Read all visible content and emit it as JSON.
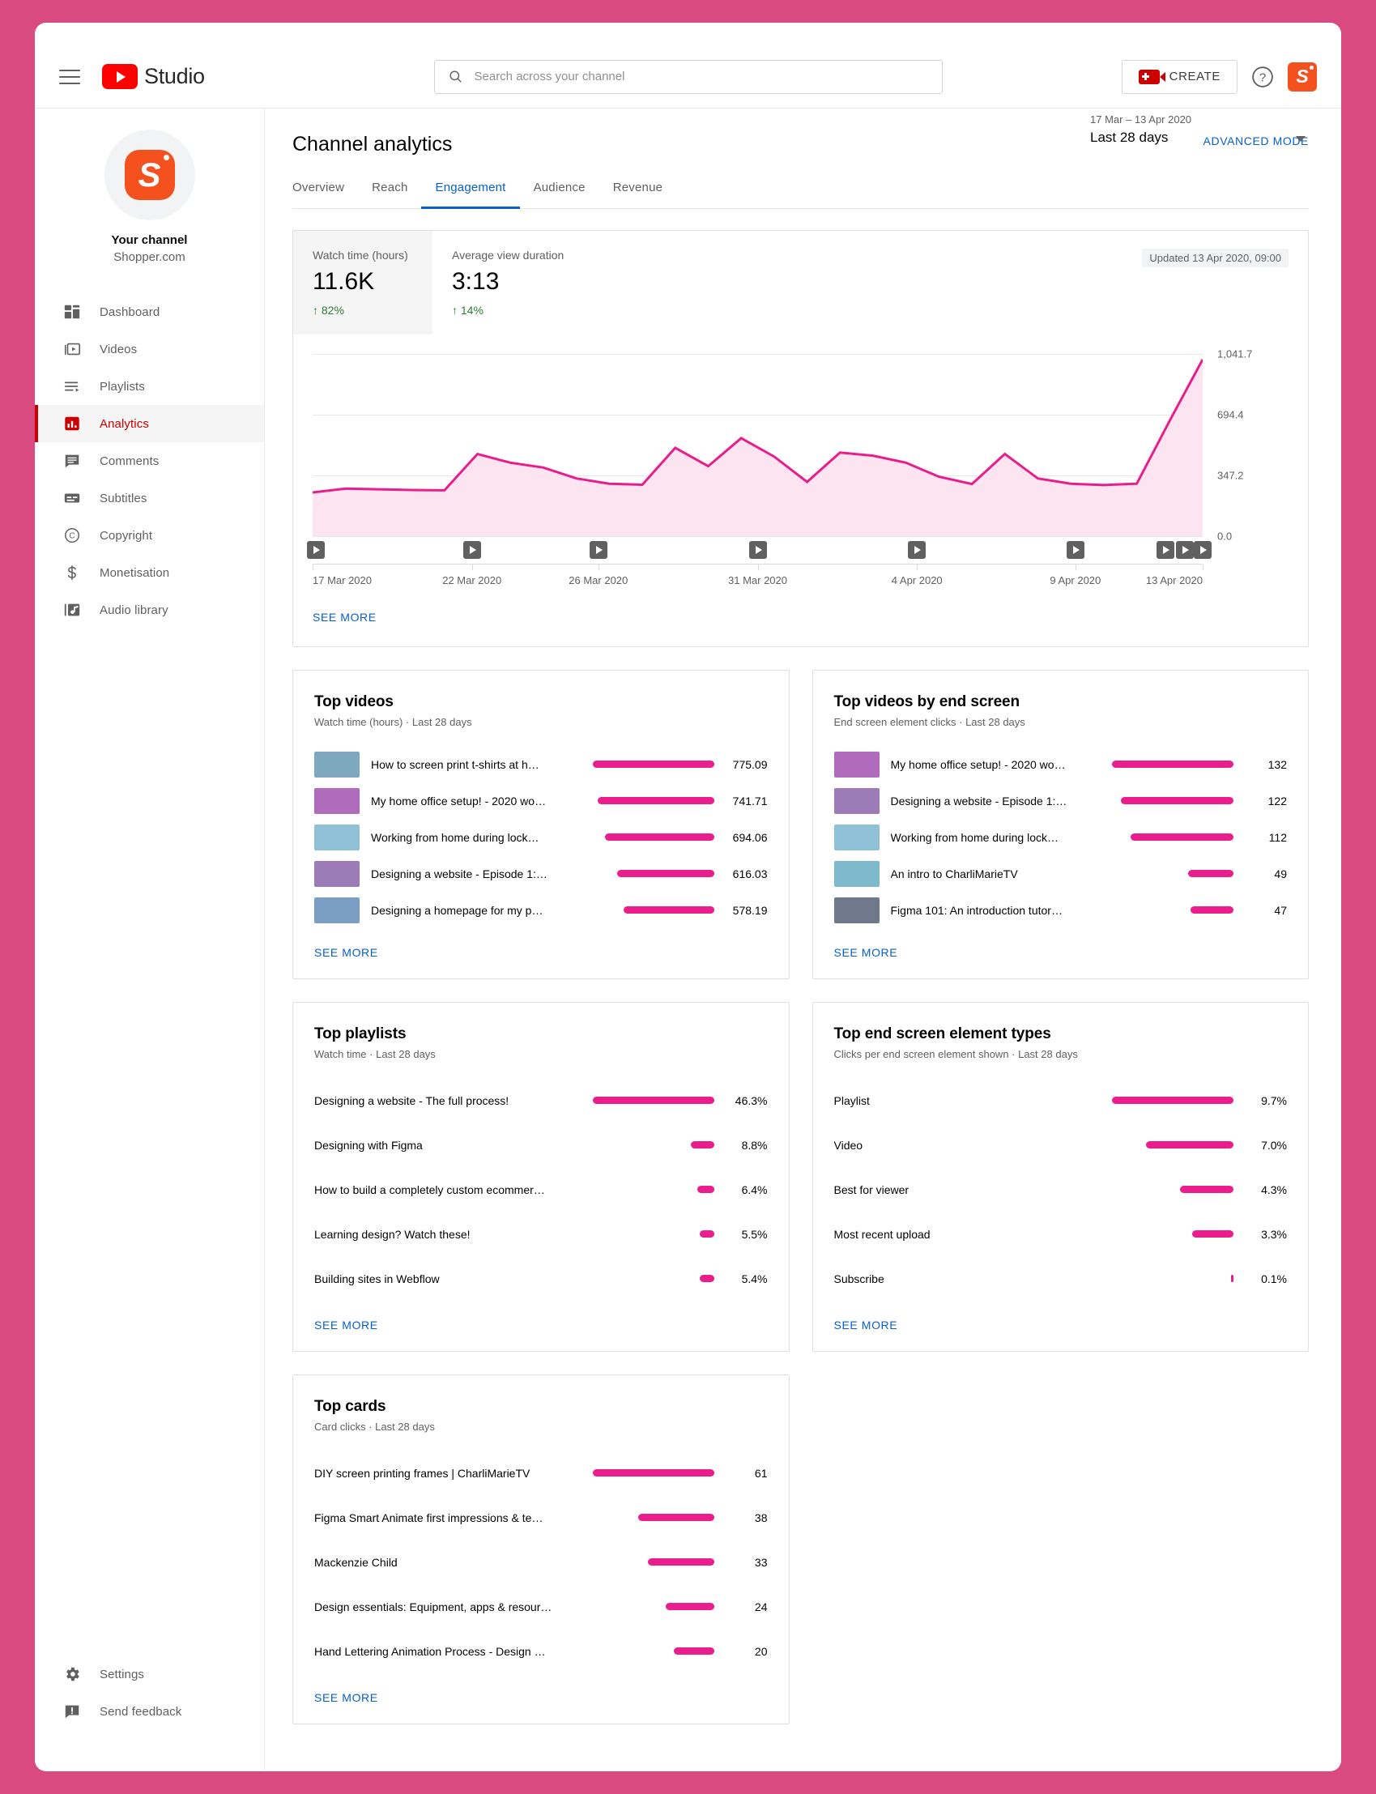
{
  "topbar": {
    "brand": "Studio",
    "search_placeholder": "Search across your channel",
    "search_value": "",
    "create_label": "CREATE",
    "avatar_letter": "S"
  },
  "sidebar": {
    "channel_label": "Your channel",
    "channel_name": "Shopper.com",
    "avatar_letter": "S",
    "items": [
      {
        "label": "Dashboard",
        "icon": "dashboard-icon",
        "active": false
      },
      {
        "label": "Videos",
        "icon": "videos-icon",
        "active": false
      },
      {
        "label": "Playlists",
        "icon": "playlists-icon",
        "active": false
      },
      {
        "label": "Analytics",
        "icon": "analytics-icon",
        "active": true
      },
      {
        "label": "Comments",
        "icon": "comments-icon",
        "active": false
      },
      {
        "label": "Subtitles",
        "icon": "subtitles-icon",
        "active": false
      },
      {
        "label": "Copyright",
        "icon": "copyright-icon",
        "active": false
      },
      {
        "label": "Monetisation",
        "icon": "dollar-icon",
        "active": false
      },
      {
        "label": "Audio library",
        "icon": "audio-library-icon",
        "active": false
      }
    ],
    "bottom_items": [
      {
        "label": "Settings",
        "icon": "gear-icon"
      },
      {
        "label": "Send feedback",
        "icon": "feedback-icon"
      }
    ]
  },
  "page": {
    "title": "Channel analytics",
    "advanced_mode": "ADVANCED MODE",
    "tabs": [
      {
        "label": "Overview",
        "active": false
      },
      {
        "label": "Reach",
        "active": false
      },
      {
        "label": "Engagement",
        "active": true
      },
      {
        "label": "Audience",
        "active": false
      },
      {
        "label": "Revenue",
        "active": false
      }
    ],
    "date_range": "17 Mar – 13 Apr 2020",
    "date_preset": "Last 28 days"
  },
  "overview_card": {
    "updated": "Updated 13 Apr 2020, 09:00",
    "see_more": "SEE MORE",
    "metrics": [
      {
        "label": "Watch time (hours)",
        "value": "11.6K",
        "delta": "82%",
        "arrow": "↑",
        "selected": true
      },
      {
        "label": "Average view duration",
        "value": "3:13",
        "delta": "14%",
        "arrow": "↑",
        "selected": false
      }
    ]
  },
  "chart_data": {
    "type": "area",
    "title": "Watch time (hours)",
    "xlabel": "",
    "ylabel": "Watch time (hours)",
    "ylim": [
      0.0,
      1041.7
    ],
    "ytick_labels": [
      "1,041.7",
      "694.4",
      "347.2",
      "0.0"
    ],
    "ytick_values": [
      1041.7,
      694.4,
      347.2,
      0.0
    ],
    "grid": true,
    "legend": "none",
    "line_color": "#e91e8c",
    "fill_color": "#fce4f0",
    "xtick_labels": [
      "17 Mar 2020",
      "22 Mar 2020",
      "26 Mar 2020",
      "31 Mar 2020",
      "4 Apr 2020",
      "9 Apr 2020",
      "13 Apr 2020"
    ],
    "xtick_positions": [
      0,
      17.9,
      32.1,
      50.0,
      67.9,
      85.7,
      100
    ],
    "x": [
      0,
      1,
      2,
      3,
      4,
      5,
      6,
      7,
      8,
      9,
      10,
      11,
      12,
      13,
      14,
      15,
      16,
      17,
      18,
      19,
      20,
      21,
      22,
      23,
      24,
      25,
      26,
      27
    ],
    "values": [
      250,
      272,
      268,
      264,
      262,
      470,
      420,
      392,
      330,
      300,
      294,
      505,
      400,
      560,
      455,
      310,
      478,
      460,
      420,
      340,
      298,
      470,
      330,
      300,
      292,
      300,
      660,
      1010
    ],
    "video_markers_pct": [
      0.4,
      17.9,
      32.1,
      50.0,
      67.9,
      85.7,
      95.8,
      98.0,
      100.0
    ]
  },
  "cards": [
    {
      "id": "top-videos",
      "title": "Top videos",
      "subtitle": "Watch time (hours) · Last 28 days",
      "see_more": "SEE MORE",
      "has_thumbs": true,
      "max": 775.09,
      "rows": [
        {
          "title": "How to screen print t-shirts at h…",
          "value": "775.09",
          "num": 775.09,
          "thumb": "#7fa8bf"
        },
        {
          "title": "My home office setup! - 2020 wo…",
          "value": "741.71",
          "num": 741.71,
          "thumb": "#b06bbd"
        },
        {
          "title": "Working from home during lock…",
          "value": "694.06",
          "num": 694.06,
          "thumb": "#8fc0d6"
        },
        {
          "title": "Designing a website - Episode 1:…",
          "value": "616.03",
          "num": 616.03,
          "thumb": "#9d7bb8"
        },
        {
          "title": "Designing a homepage for my p…",
          "value": "578.19",
          "num": 578.19,
          "thumb": "#7a9ec4"
        }
      ]
    },
    {
      "id": "top-videos-end-screen",
      "title": "Top videos by end screen",
      "subtitle": "End screen element clicks · Last 28 days",
      "see_more": "SEE MORE",
      "has_thumbs": true,
      "max": 132,
      "rows": [
        {
          "title": "My home office setup! - 2020 wo…",
          "value": "132",
          "num": 132,
          "thumb": "#b06bbd"
        },
        {
          "title": "Designing a website - Episode 1:…",
          "value": "122",
          "num": 122,
          "thumb": "#9d7bb8"
        },
        {
          "title": "Working from home during lock…",
          "value": "112",
          "num": 112,
          "thumb": "#8fc0d6"
        },
        {
          "title": "An intro to CharliMarieTV",
          "value": "49",
          "num": 49,
          "thumb": "#7fb9cc"
        },
        {
          "title": "Figma 101: An introduction tutor…",
          "value": "47",
          "num": 47,
          "thumb": "#6e7a8c"
        }
      ]
    },
    {
      "id": "top-playlists",
      "title": "Top playlists",
      "subtitle": "Watch time · Last 28 days",
      "see_more": "SEE MORE",
      "has_thumbs": false,
      "max": 46.3,
      "rows": [
        {
          "title": "Designing a website - The full process!",
          "value": "46.3%",
          "num": 46.3
        },
        {
          "title": "Designing with Figma",
          "value": "8.8%",
          "num": 8.8
        },
        {
          "title": "How to build a completely custom ecommer…",
          "value": "6.4%",
          "num": 6.4
        },
        {
          "title": "Learning design? Watch these!",
          "value": "5.5%",
          "num": 5.5
        },
        {
          "title": "Building sites in Webflow",
          "value": "5.4%",
          "num": 5.4
        }
      ]
    },
    {
      "id": "top-end-screen-element-types",
      "title": "Top end screen element types",
      "subtitle": "Clicks per end screen element shown · Last 28 days",
      "see_more": "SEE MORE",
      "has_thumbs": false,
      "max": 9.7,
      "rows": [
        {
          "title": "Playlist",
          "value": "9.7%",
          "num": 9.7
        },
        {
          "title": "Video",
          "value": "7.0%",
          "num": 7.0
        },
        {
          "title": "Best for viewer",
          "value": "4.3%",
          "num": 4.3
        },
        {
          "title": "Most recent upload",
          "value": "3.3%",
          "num": 3.3
        },
        {
          "title": "Subscribe",
          "value": "0.1%",
          "num": 0.1
        }
      ]
    },
    {
      "id": "top-cards",
      "title": "Top cards",
      "subtitle": "Card clicks · Last 28 days",
      "see_more": "SEE MORE",
      "has_thumbs": false,
      "max": 61,
      "rows": [
        {
          "title": "DIY screen printing frames | CharliMarieTV",
          "value": "61",
          "num": 61
        },
        {
          "title": "Figma Smart Animate first impressions & te…",
          "value": "38",
          "num": 38
        },
        {
          "title": "Mackenzie Child",
          "value": "33",
          "num": 33
        },
        {
          "title": "Design essentials: Equipment, apps & resour…",
          "value": "24",
          "num": 24
        },
        {
          "title": "Hand Lettering Animation Process - Design …",
          "value": "20",
          "num": 20
        }
      ]
    }
  ]
}
